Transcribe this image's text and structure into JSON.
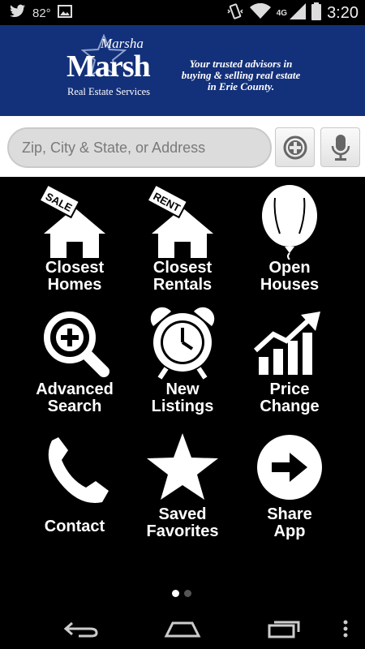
{
  "status_bar": {
    "temperature": "82°",
    "network": "4G",
    "time": "3:20",
    "icons": [
      "twitter-icon",
      "image-icon",
      "vibrate-icon",
      "wifi-icon",
      "signal-icon",
      "battery-icon"
    ]
  },
  "header": {
    "logo_line1": "Marsha",
    "logo_line2": "Marsh",
    "logo_line3": "Real Estate Services",
    "tagline": [
      "Your trusted advisors in",
      "buying & selling real estate",
      "in Erie County."
    ],
    "brand_color": "#13307a"
  },
  "search": {
    "placeholder": "Zip, City & State, or Address",
    "value": ""
  },
  "menu": {
    "closest_homes": [
      "Closest",
      "Homes"
    ],
    "closest_rentals": [
      "Closest",
      "Rentals"
    ],
    "open_houses": [
      "Open",
      "Houses"
    ],
    "advanced_search": [
      "Advanced",
      "Search"
    ],
    "new_listings": [
      "New",
      "Listings"
    ],
    "price_change": [
      "Price",
      "Change"
    ],
    "contact": [
      "Contact"
    ],
    "saved_favorites": [
      "Saved",
      "Favorites"
    ],
    "share_app": [
      "Share",
      "App"
    ],
    "sign_sale": "SALE",
    "sign_rent": "RENT"
  },
  "pager": {
    "pages": 2,
    "current": 1
  }
}
